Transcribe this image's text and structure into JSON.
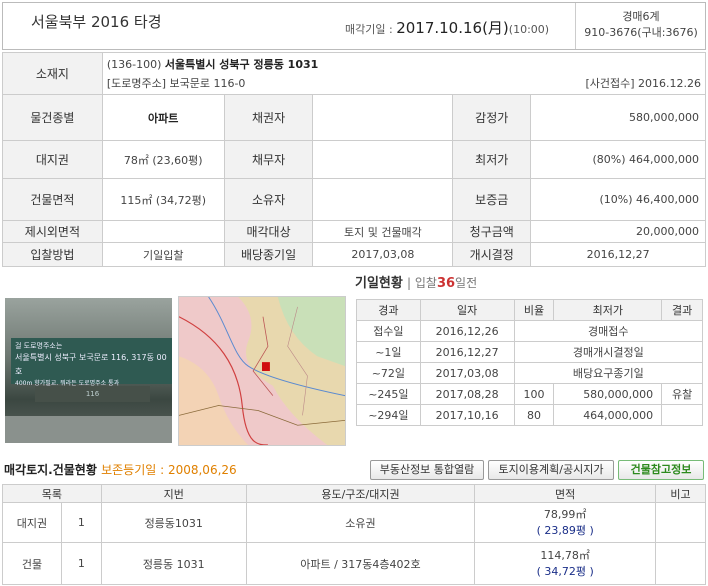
{
  "header": {
    "court_case": "서울북부  2016 타경",
    "sale_date_label": "매각기일 :",
    "sale_date": "2017.10.16(月)",
    "sale_time": "(10:00)",
    "dept": "경매6계",
    "phone": "910-3676(구내:3676)"
  },
  "info": {
    "location_label": "소재지",
    "address_code": "(136-100)",
    "address": "서울특별시 성북구 정릉동 1031",
    "road_address": "[도로명주소] 보국문로 116-0",
    "case_received": "[사건접수] 2016.12.26",
    "rows": [
      {
        "l1": "물건종별",
        "v1": "아파트",
        "l2": "채권자",
        "v2": "",
        "l3": "감정가",
        "v3": "580,000,000"
      },
      {
        "l1": "대지권",
        "v1": "78㎡ (23,60평)",
        "l2": "채무자",
        "v2": "",
        "l3": "최저가",
        "v3": "(80%) 464,000,000"
      },
      {
        "l1": "건물면적",
        "v1": "115㎡ (34,72평)",
        "l2": "소유자",
        "v2": "",
        "l3": "보증금",
        "v3": "(10%) 46,400,000"
      },
      {
        "l1": "제시외면적",
        "v1": "",
        "l2": "매각대상",
        "v2": "토지 및 건물매각",
        "l3": "청구금액",
        "v3": "20,000,000"
      },
      {
        "l1": "입찰방법",
        "v1": "기일입찰",
        "l2": "배당종기일",
        "v2": "2017,03,08",
        "l3": "개시결정",
        "v3": "2016,12,27"
      }
    ]
  },
  "photo": {
    "sign_small": "걸 도로명주소는",
    "sign_main": "서울특별시 성북구 보국문로 116, 317동 00호",
    "sign_sub": "400m 향가필교. 뭐라든 도로명주소 통과",
    "plate": "116"
  },
  "auction_status": {
    "title": "기일현황",
    "sub_prefix": "입찰",
    "days": "36",
    "sub_suffix": "일전",
    "headers": [
      "경과",
      "일자",
      "비율",
      "최저가",
      "결과"
    ],
    "rows": [
      {
        "elapsed": "접수일",
        "date": "2016,12,26",
        "merged": "경매접수"
      },
      {
        "elapsed": "~1일",
        "date": "2016,12,27",
        "merged": "경매개시결정일"
      },
      {
        "elapsed": "~72일",
        "date": "2017,03,08",
        "merged": "배당요구종기일"
      },
      {
        "elapsed": "~245일",
        "date": "2017,08,28",
        "ratio": "100",
        "price": "580,000,000",
        "result": "유찰"
      },
      {
        "elapsed": "~294일",
        "date": "2017,10,16",
        "ratio": "80",
        "price": "464,000,000",
        "result": ""
      }
    ]
  },
  "land": {
    "title": "매각토지.건물현황",
    "preserve": "보존등기일 : 2008,06,26",
    "buttons": [
      "부동산정보 통합열람",
      "토지이용계획/공시지가",
      "건물참고정보"
    ],
    "headers": [
      "목록",
      "지번",
      "용도/구조/대지권",
      "면적",
      "비고"
    ],
    "rows": [
      {
        "type": "대지권",
        "no": "1",
        "lot": "정릉동1031",
        "use": "소유권",
        "area": "78,99㎡",
        "pyeong": "( 23,89평 )"
      },
      {
        "type": "건물",
        "no": "1",
        "lot": "정릉동 1031",
        "use": "아파트 / 317동4층402호",
        "area": "114,78㎡",
        "pyeong": "( 34,72평 )"
      }
    ]
  },
  "colors": {
    "accent_red": "#cc3333",
    "accent_blue": "#2a6ab0",
    "accent_orange": "#e08000",
    "accent_green": "#2d8a1e"
  }
}
